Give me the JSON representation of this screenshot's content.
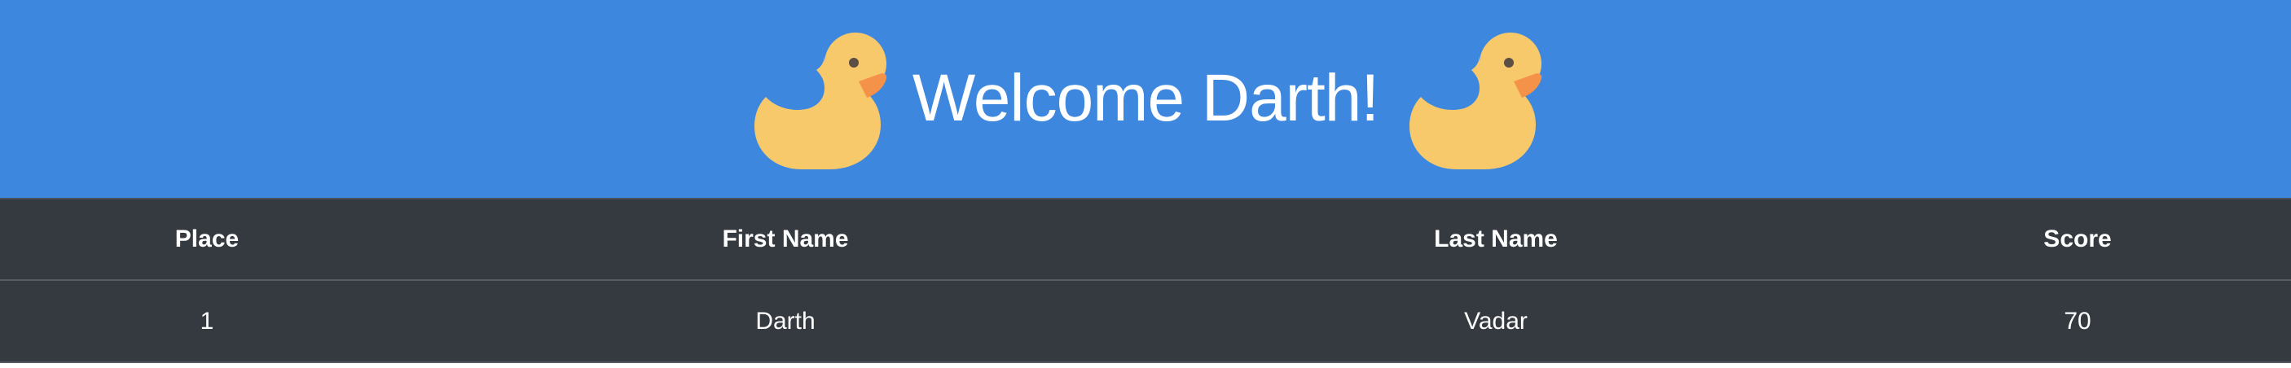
{
  "banner": {
    "title": "Welcome Darth!",
    "background_color": "#3d88de",
    "left_icon": "rubber-duck-icon",
    "right_icon": "rubber-duck-icon"
  },
  "table": {
    "headers": [
      "Place",
      "First Name",
      "Last Name",
      "Score"
    ],
    "rows": [
      [
        "1",
        "Darth",
        "Vadar",
        "70"
      ]
    ],
    "background_color": "#343a40"
  }
}
